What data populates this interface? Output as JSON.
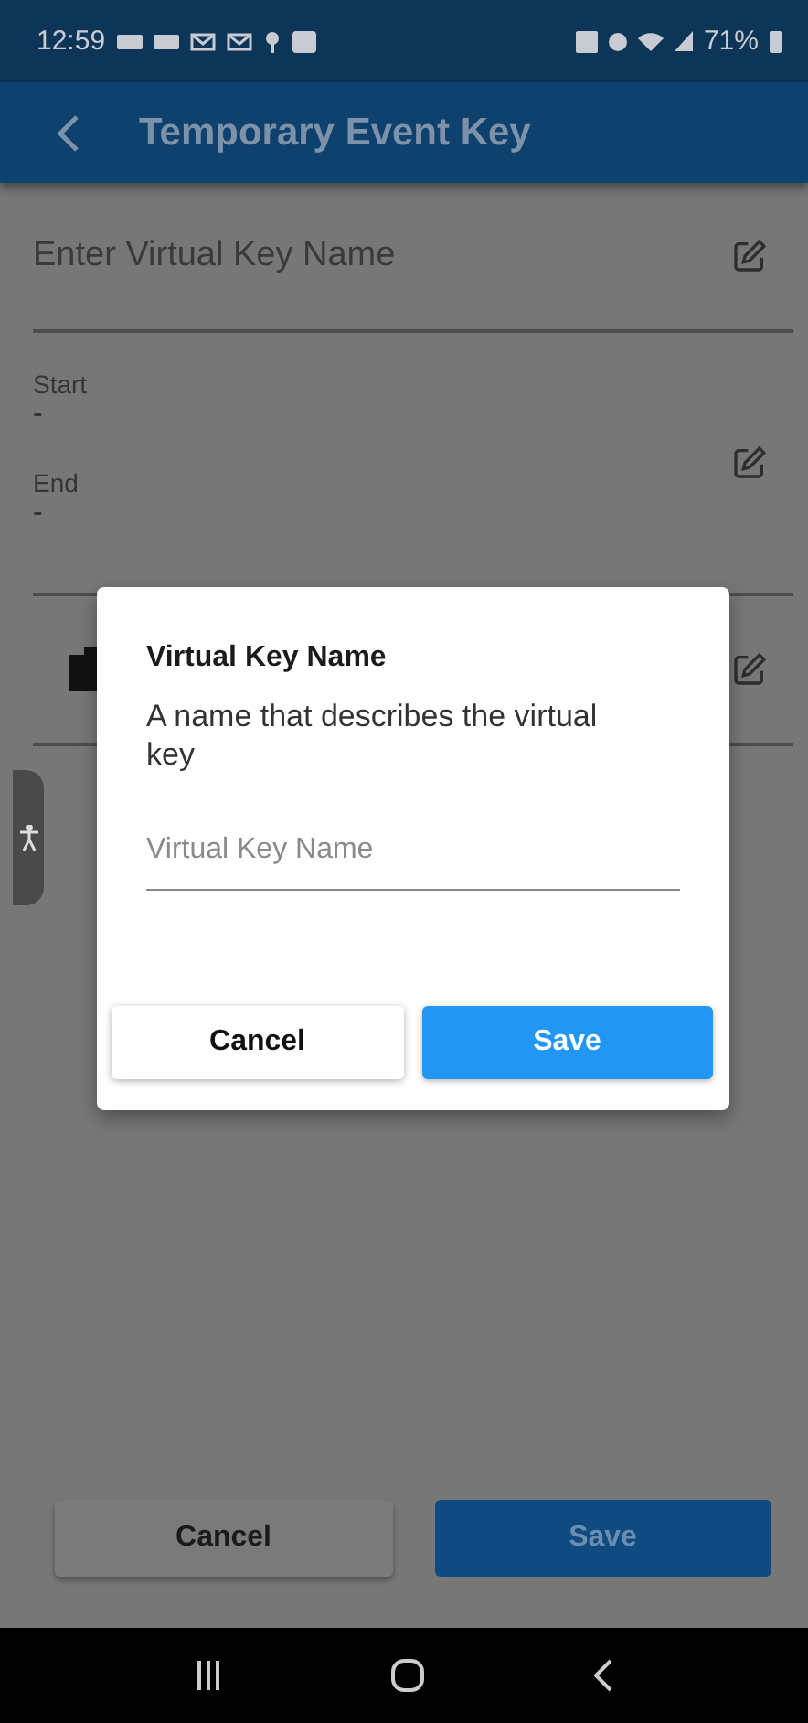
{
  "status_bar": {
    "time": "12:59",
    "battery": "71%"
  },
  "app_bar": {
    "title": "Temporary Event Key"
  },
  "name_field": {
    "placeholder": "Enter Virtual Key Name"
  },
  "schedule": [
    {
      "label": "Start",
      "value": "-"
    },
    {
      "label": "End",
      "value": "-"
    }
  ],
  "footer": {
    "buttons": [
      {
        "label": "Cancel",
        "kind": "secondary"
      },
      {
        "label": "Save",
        "kind": "primary"
      }
    ]
  },
  "dialog": {
    "title": "Virtual Key Name",
    "description": "A name that describes the virtual key",
    "field": {
      "placeholder": "Virtual Key Name"
    },
    "buttons": [
      {
        "label": "Cancel",
        "kind": "secondary"
      },
      {
        "label": "Save",
        "kind": "primary"
      }
    ]
  }
}
